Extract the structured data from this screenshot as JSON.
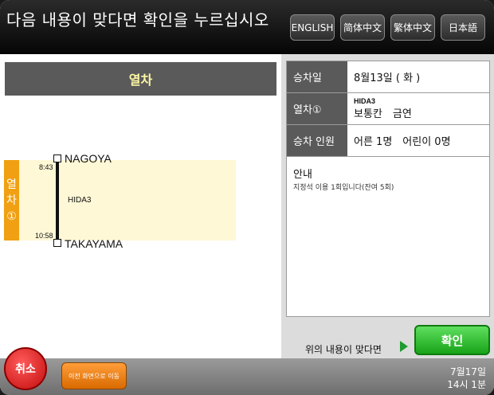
{
  "header": {
    "title": "다음 내용이 맞다면 확인을 누르십시오",
    "languages": [
      "ENGLISH",
      "简体中文",
      "繁体中文",
      "日本語"
    ]
  },
  "left": {
    "section_title": "열차",
    "tab_label_chars": [
      "열",
      "차",
      "①"
    ],
    "departure_station": "NAGOYA",
    "arrival_station": "TAKAYAMA",
    "departure_time": "8:43",
    "arrival_time": "10:58",
    "train_code": "HIDA3"
  },
  "details": {
    "date_label": "승차일",
    "date_value": "8월13일 ( 화 )",
    "train_label": "열차①",
    "train_name": "HIDA3",
    "train_detail": "보통칸　금연",
    "passengers_label": "승차 인원",
    "passengers_value": "어른 1명　어린이 0명",
    "notice_title": "안내",
    "notice_text": "지정석 이용 1회입니다(잔여 5회)"
  },
  "confirm": {
    "prompt": "위의 내용이 맞다면",
    "button_label": "확인"
  },
  "footer": {
    "cancel_label": "취소",
    "back_label": "이전 화면으로 이동",
    "date": "7월17일",
    "time": "14시 1분"
  },
  "colors": {
    "accent_orange": "#f0a012",
    "confirm_green": "#18a318",
    "cancel_red": "#c30d0d",
    "header_title_yellow": "#fdf6a5"
  }
}
